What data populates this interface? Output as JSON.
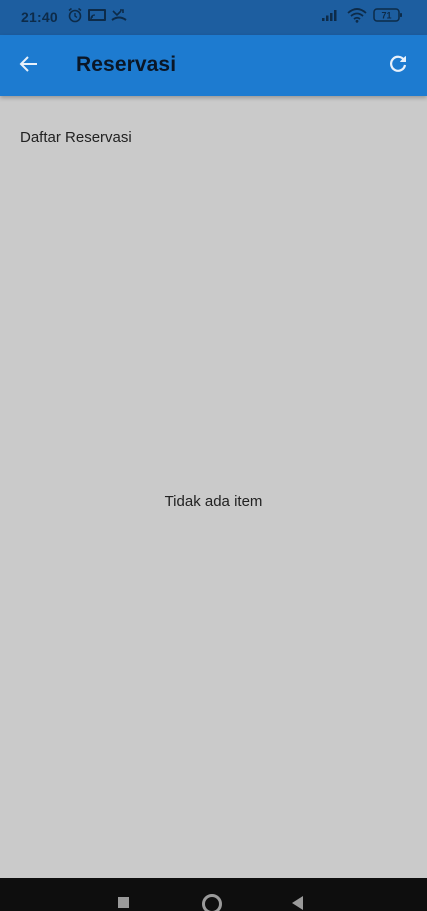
{
  "status_bar": {
    "time": "21:40",
    "battery_level": "71",
    "icons_left": [
      "alarm-icon",
      "cast-icon",
      "missed-call-icon"
    ],
    "icons_right": [
      "signal-icon",
      "wifi-icon",
      "battery-icon"
    ]
  },
  "app_bar": {
    "title": "Reservasi",
    "back_icon": "arrow-back-icon",
    "refresh_icon": "refresh-icon",
    "background_color": "#1d7bd0"
  },
  "content": {
    "section_label": "Daftar Reservasi",
    "empty_message": "Tidak ada item",
    "background_color": "#cacaca"
  },
  "nav_bar": {
    "icons": [
      "recents-icon",
      "home-icon",
      "back-triangle-icon"
    ]
  }
}
